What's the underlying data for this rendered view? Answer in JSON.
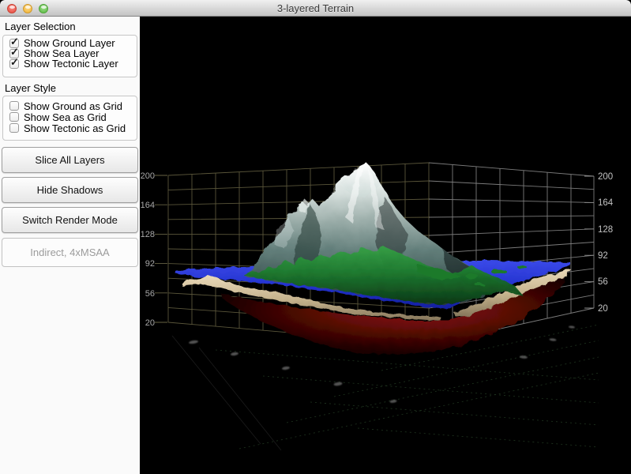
{
  "window": {
    "title": "3-layered Terrain",
    "traffic_lights": [
      "close",
      "minimize",
      "zoom"
    ]
  },
  "sidebar": {
    "layer_selection": {
      "label": "Layer Selection",
      "items": [
        {
          "label": "Show Ground Layer",
          "checked": true,
          "glyph": "✓"
        },
        {
          "label": "Show Sea Layer",
          "checked": true,
          "glyph": "✓"
        },
        {
          "label": "Show Tectonic Layer",
          "checked": true,
          "glyph": "✓"
        }
      ]
    },
    "layer_style": {
      "label": "Layer Style",
      "items": [
        {
          "label": "Show Ground as Grid",
          "checked": false,
          "glyph": ""
        },
        {
          "label": "Show Sea as Grid",
          "checked": false,
          "glyph": ""
        },
        {
          "label": "Show Tectonic as Grid",
          "checked": false,
          "glyph": ""
        }
      ]
    },
    "buttons": [
      {
        "label": "Slice All Layers"
      },
      {
        "label": "Hide Shadows"
      },
      {
        "label": "Switch Render Mode"
      }
    ],
    "status": {
      "label": "Indirect, 4xMSAA"
    }
  },
  "scene": {
    "left_axis_ticks": [
      "200",
      "164",
      "128",
      "92",
      "56",
      "20"
    ],
    "right_axis_ticks": [
      "200",
      "164",
      "128",
      "92",
      "56",
      "20"
    ],
    "layers": [
      "ground",
      "sea",
      "tectonic"
    ],
    "colors": {
      "background": "#000000",
      "left_wall_grid": "#6a6545",
      "right_wall_grid": "#9a9a9a",
      "floor_grid": "#3f6a3f",
      "sea": "#2533cc",
      "ground_rock": "#c7d2d0",
      "ground_vegetation": "#1d7a2e",
      "ground_edge_tan": "#d0bf9c",
      "tectonic_red": "#6e0b07",
      "snow": "#ffffff"
    }
  }
}
